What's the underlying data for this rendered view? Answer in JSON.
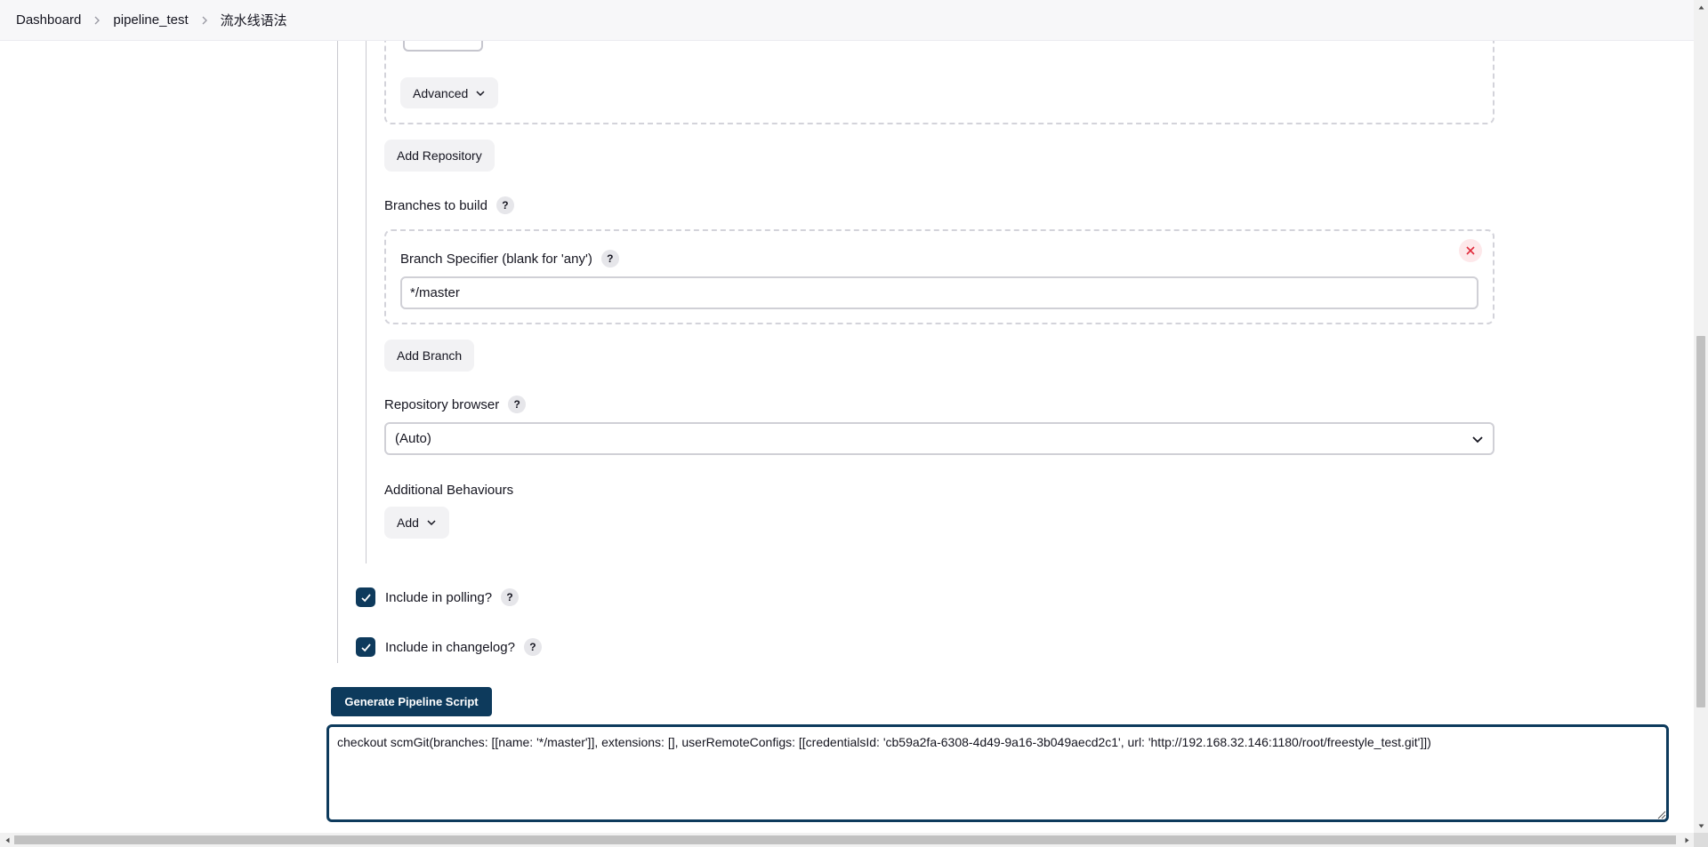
{
  "breadcrumb": {
    "items": [
      "Dashboard",
      "pipeline_test",
      "流水线语法"
    ],
    "separator_icon": "chevron-right-icon"
  },
  "repository": {
    "advanced_label": "Advanced",
    "add_repository_label": "Add Repository"
  },
  "branches": {
    "section_label": "Branches to build",
    "specifier_label": "Branch Specifier (blank for 'any')",
    "specifier_value": "*/master",
    "add_branch_label": "Add Branch"
  },
  "repository_browser": {
    "label": "Repository browser",
    "selected": "(Auto)"
  },
  "additional_behaviours": {
    "label": "Additional Behaviours",
    "add_label": "Add"
  },
  "options": {
    "include_polling_label": "Include in polling?",
    "include_polling_checked": true,
    "include_changelog_label": "Include in changelog?",
    "include_changelog_checked": true
  },
  "generate": {
    "button_label": "Generate Pipeline Script",
    "script": "checkout scmGit(branches: [[name: '*/master']], extensions: [], userRemoteConfigs: [[credentialsId: 'cb59a2fa-6308-4d49-9a16-3b049aecd2c1', url: 'http://192.168.32.146:1180/root/freestyle_test.git']])"
  },
  "help_glyph": "?",
  "colors": {
    "primary": "#0d3a5c",
    "danger": "#e0293a",
    "button_gray": "#f2f2f4",
    "dashed_border": "#d3d3da"
  }
}
